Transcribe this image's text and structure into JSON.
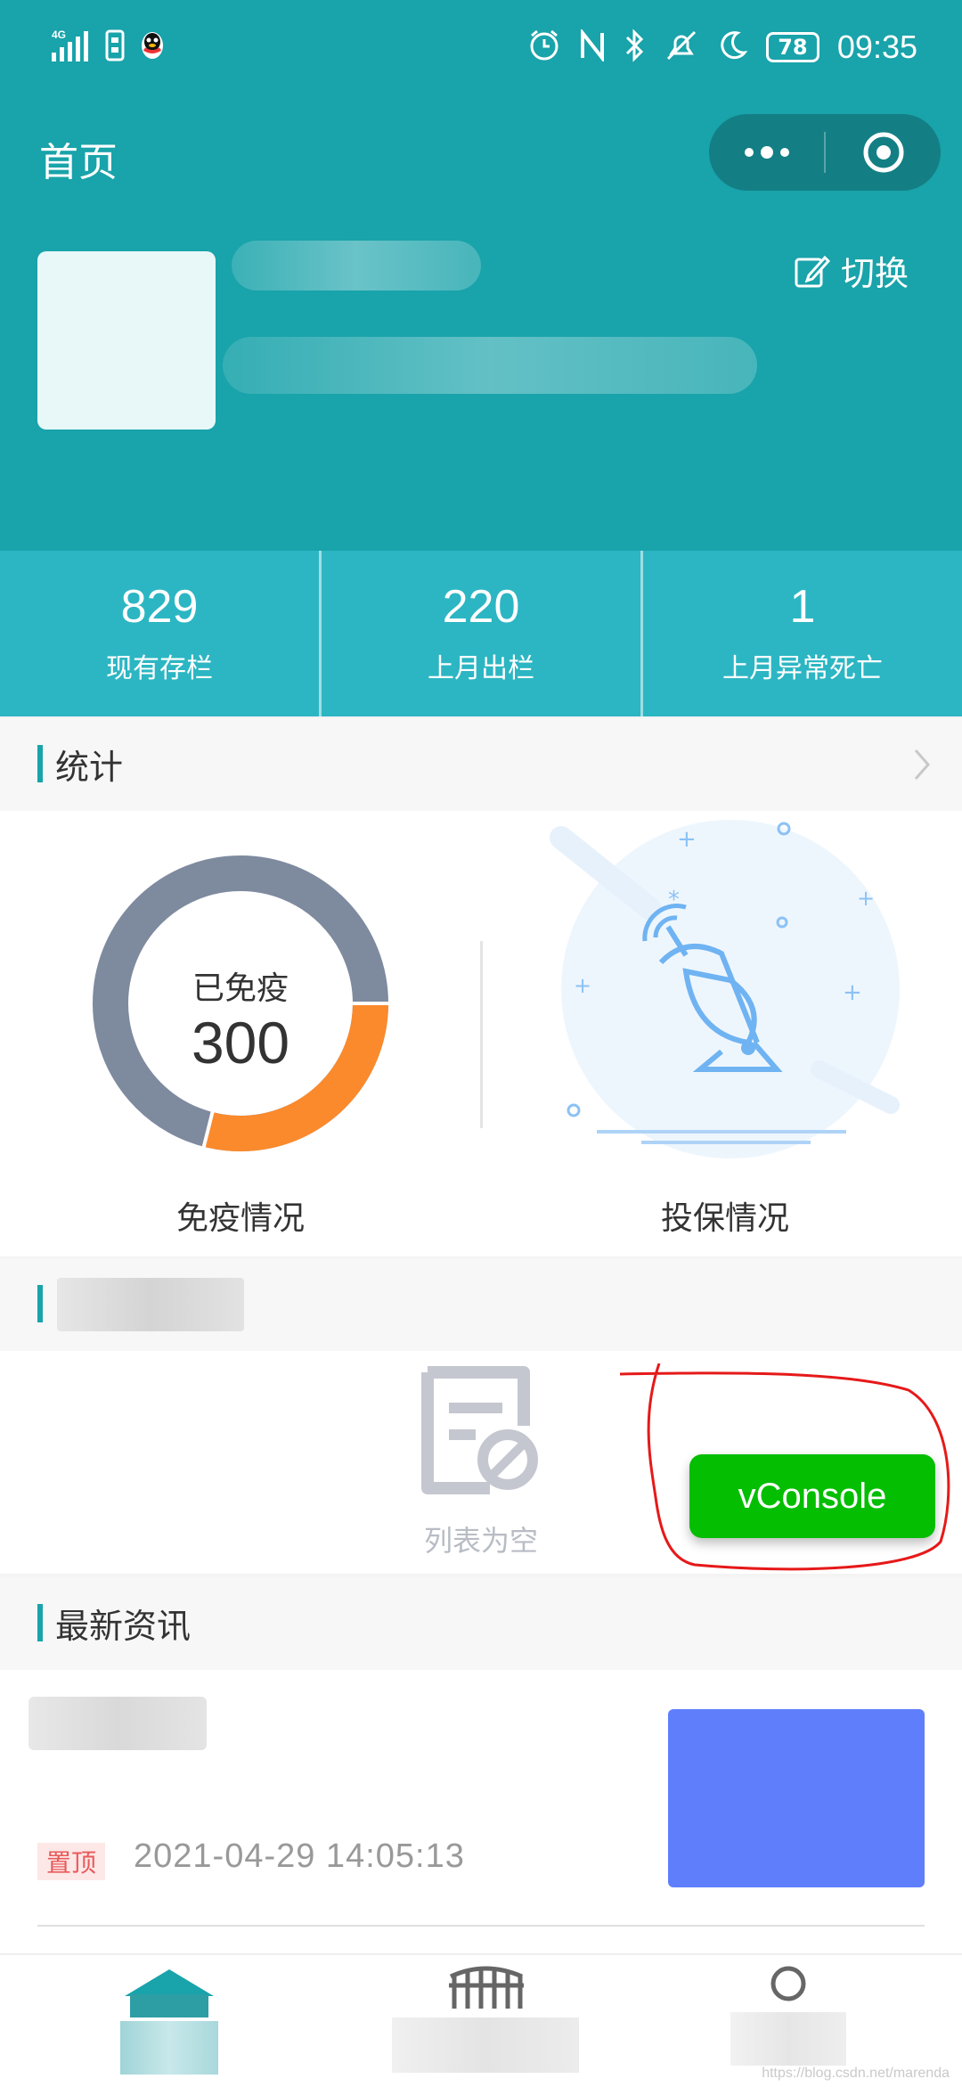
{
  "status_bar": {
    "network": "4G",
    "battery": "78",
    "time": "09:35"
  },
  "nav": {
    "title": "首页"
  },
  "profile": {
    "switch_label": "切换"
  },
  "stats": [
    {
      "value": "829",
      "label": "现有存栏"
    },
    {
      "value": "220",
      "label": "上月出栏"
    },
    {
      "value": "1",
      "label": "上月异常死亡"
    }
  ],
  "sections": {
    "stats_title": "统计",
    "news_title": "最新资讯"
  },
  "vaccine": {
    "label": "已免疫",
    "value": "300",
    "caption": "免疫情况",
    "colors": {
      "main": "#7e8a9e",
      "accent": "#fb8a2c"
    }
  },
  "insurance": {
    "caption": "投保情况"
  },
  "empty_list": {
    "text": "列表为空"
  },
  "vconsole": {
    "label": "vConsole"
  },
  "news": {
    "tag": "置顶",
    "date": "2021-04-29 14:05:13",
    "thumb_color": "#5f7efc"
  },
  "watermark": "https://blog.csdn.net/marenda"
}
